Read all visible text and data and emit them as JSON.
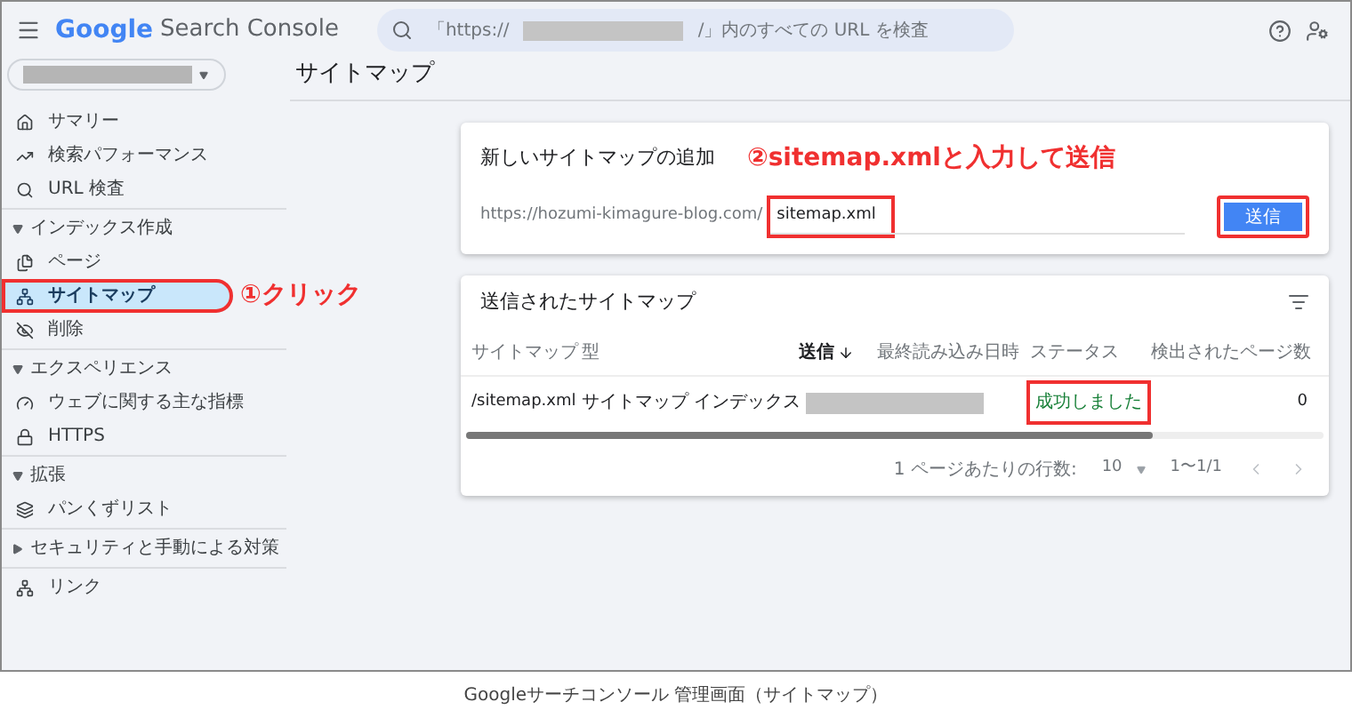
{
  "header": {
    "logo": "Google",
    "product": "Search Console",
    "search": {
      "prefix": "「https://",
      "suffix": "/」内のすべての URL を検査"
    }
  },
  "page_title": "サイトマップ",
  "sidebar": {
    "groups": [
      {
        "items": [
          {
            "label": "サマリー",
            "selected": false,
            "highlighted": false
          },
          {
            "label": "検索パフォーマンス",
            "selected": false,
            "highlighted": false
          },
          {
            "label": "URL 検査",
            "selected": false,
            "highlighted": false
          }
        ]
      },
      {
        "title": "インデックス作成",
        "expanded": true,
        "items": [
          {
            "label": "ページ",
            "selected": false,
            "highlighted": false
          },
          {
            "label": "サイトマップ",
            "selected": true,
            "highlighted": true
          },
          {
            "label": "削除",
            "selected": false,
            "highlighted": false
          }
        ]
      },
      {
        "title": "エクスペリエンス",
        "expanded": true,
        "items": [
          {
            "label": "ウェブに関する主な指標",
            "selected": false,
            "highlighted": false
          },
          {
            "label": "HTTPS",
            "selected": false,
            "highlighted": false
          }
        ]
      },
      {
        "title": "拡張",
        "expanded": true,
        "items": [
          {
            "label": "パンくずリスト",
            "selected": false,
            "highlighted": false
          }
        ]
      },
      {
        "title": "セキュリティと手動による対策",
        "expanded": false
      },
      {
        "items": [
          {
            "label": "リンク",
            "selected": false,
            "highlighted": false
          }
        ]
      }
    ]
  },
  "add_card": {
    "title": "新しいサイトマップの追加",
    "url_prefix": "https://hozumi-kimagure-blog.com/",
    "input": {
      "value": "sitemap.xml",
      "highlighted": true
    },
    "submit": {
      "label": "送信",
      "highlighted": true
    }
  },
  "list_card": {
    "title": "送信されたサイトマップ",
    "table": {
      "columns": [
        {
          "label": "サイトマップ",
          "sorted": false
        },
        {
          "label": "型",
          "sorted": false
        },
        {
          "label": "送信",
          "sorted": true
        },
        {
          "label": "最終読み込み日時",
          "sorted": false
        },
        {
          "label": "ステータス",
          "sorted": false
        },
        {
          "label": "検出されたページ数",
          "sorted": false
        }
      ],
      "rows": [
        {
          "sitemap": "/sitemap.xml",
          "type": "サイトマップ インデックス",
          "status": "成功しました",
          "status_highlighted": true,
          "pages": "0"
        }
      ]
    },
    "pagination": {
      "rows_label": "1 ページあたりの行数:",
      "rows_value": "10",
      "range": "1〜1/1"
    }
  },
  "annotations": {
    "step1": "①クリック",
    "step2": "②sitemap.xmlと入力して送信"
  },
  "caption": "Googleサーチコンソール 管理画面（サイトマップ）"
}
